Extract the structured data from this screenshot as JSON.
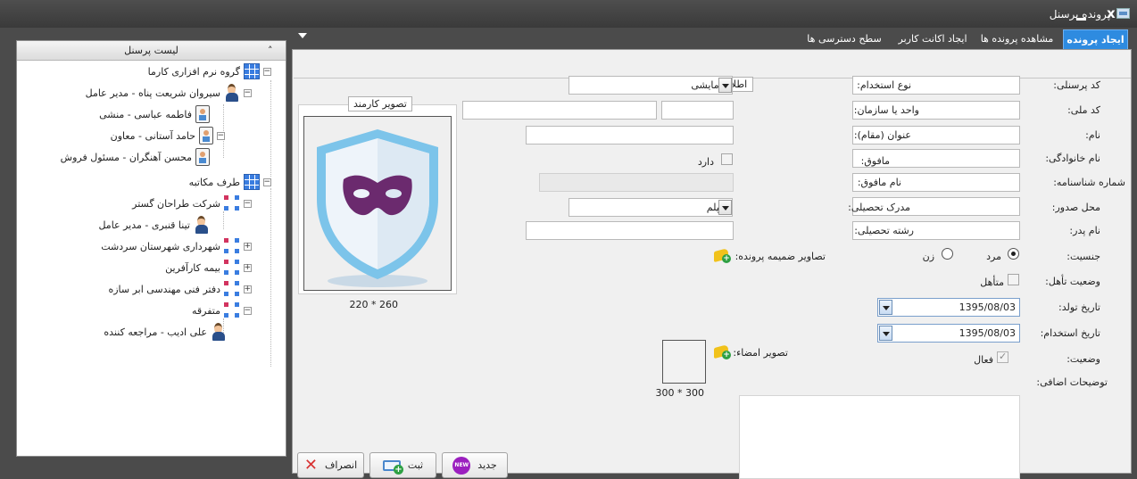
{
  "window": {
    "title": "پرونده پرسنل",
    "close": "x"
  },
  "left_panel": {
    "title": "لیست پرسنل",
    "collapse": "˄",
    "tree": [
      {
        "label": "گروه نرم افزاری کارما",
        "icon": "grid-icon",
        "expander": "−"
      },
      {
        "label": "سیروان شریعت پناه - مدیر عامل",
        "icon": "user-icon",
        "expander": "−"
      },
      {
        "label": "فاطمه عباسی - منشی",
        "icon": "badge-icon"
      },
      {
        "label": "حامد آستانی - معاون",
        "icon": "badge-icon",
        "expander": "−"
      },
      {
        "label": "محسن آهنگران - مسئول فروش",
        "icon": "badge-icon"
      },
      {
        "label": "طرف مکاتبه",
        "icon": "grid-icon",
        "expander": "−"
      },
      {
        "label": "شرکت طراحان گستر",
        "icon": "org-icon",
        "expander": "−"
      },
      {
        "label": "تینا قنبری - مدیر عامل",
        "icon": "user-icon"
      },
      {
        "label": "شهرداری شهرستان سردشت",
        "icon": "org-icon",
        "expander": "+"
      },
      {
        "label": "بیمه کارآفرین",
        "icon": "org-icon",
        "expander": "+"
      },
      {
        "label": "دفتر فنی مهندسی ابر سازه",
        "icon": "org-icon",
        "expander": "+"
      },
      {
        "label": "متفرقه",
        "icon": "org-icon",
        "expander": "−"
      },
      {
        "label": "علی ادیب - مراجعه کننده",
        "icon": "user-icon"
      }
    ]
  },
  "tabs": [
    {
      "label": "ایجاد پرونده",
      "active": true
    },
    {
      "label": "مشاهده پرونده ها"
    },
    {
      "label": "ایجاد اکانت کاربر"
    },
    {
      "label": "سطح دسترسی ها"
    }
  ],
  "form": {
    "group_title": "اطلاعات شخصی",
    "personnel_code": "کد پرسنلی:",
    "national_code": "کد ملی:",
    "first_name": "نام:",
    "last_name": "نام خانوادگی:",
    "id_number": "شماره شناسنامه:",
    "issue_place": "محل صدور:",
    "father_name": "نام پدر:",
    "gender": "جنسیت:",
    "male": "مرد",
    "female": "زن",
    "marital": "وضعیت تأهل:",
    "married": "متأهل",
    "birth_date": "تاریخ تولد:",
    "birth_date_value": "1395/08/03",
    "hire_date": "تاریخ استخدام:",
    "hire_date_value": "1395/08/03",
    "status": "وضعیت:",
    "active": "فعال",
    "notes": "توضیحات اضافی:",
    "employment_type": "نوع استخدام:",
    "employment_type_value": "آزمایشی",
    "unit": "واحد یا سازمان:",
    "title": "عنوان (مقام):",
    "supervisor": "مافوق:",
    "has": "دارد",
    "supervisor_name": "نام مافوق:",
    "education": "مدرک تحصیلی:",
    "education_value": "دیپلم",
    "field": "رشته تحصیلی:",
    "attachments": "تصاویر ضمیمه پرونده:",
    "signature": "تصویر امضاء:",
    "signature_size": "300 * 300",
    "photo_title": "تصویر کارمند",
    "photo_size": "260 * 220"
  },
  "buttons": {
    "new": "جدید",
    "save": "ثبت",
    "cancel": "انصراف",
    "new_icon_text": "NEW"
  },
  "colors": {
    "accent": "#2e8be0",
    "chrome": "#4b4b4b",
    "shield": "#7cc4ea",
    "mask": "#6b2a6e"
  }
}
